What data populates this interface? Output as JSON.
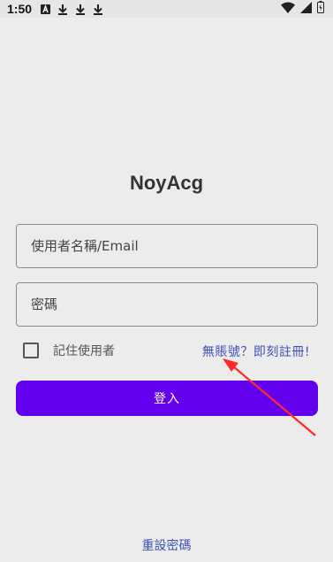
{
  "status_bar": {
    "time": "1:50",
    "icons": [
      "notification-a-icon",
      "download-icon",
      "download-icon",
      "download-icon",
      "wifi-icon",
      "signal-icon",
      "battery-icon"
    ]
  },
  "app": {
    "title": "NoyAcg"
  },
  "form": {
    "username_placeholder": "使用者名稱/Email",
    "password_placeholder": "密碼",
    "remember_label": "記住使用者",
    "register_link": "無賬號？即刻註冊!",
    "login_button": "登入",
    "reset_link": "重設密碼"
  },
  "colors": {
    "primary": "#6200ee",
    "link": "#3f51b5",
    "annotation": "#ff2a2a"
  }
}
